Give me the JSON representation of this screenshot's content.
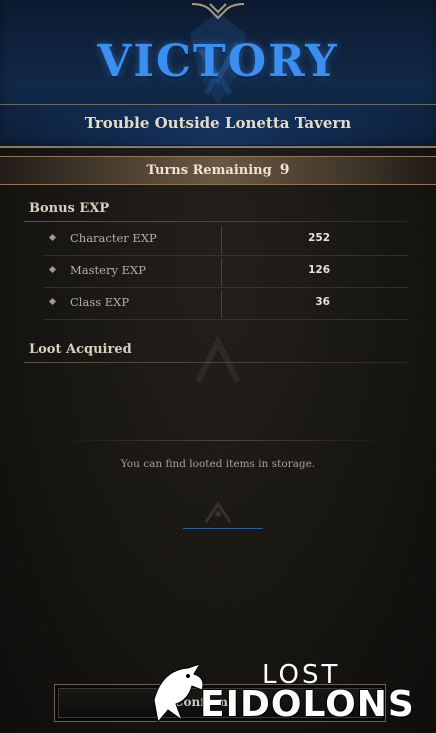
{
  "header": {
    "title": "VICTORY",
    "stage_name": "Trouble Outside Lonetta Tavern"
  },
  "turns": {
    "label": "Turns Remaining",
    "value": "9"
  },
  "bonus_exp": {
    "title": "Bonus EXP",
    "rows": [
      {
        "label": "Character EXP",
        "value": "252"
      },
      {
        "label": "Mastery EXP",
        "value": "126"
      },
      {
        "label": "Class EXP",
        "value": "36"
      }
    ]
  },
  "loot": {
    "title": "Loot Acquired",
    "note": "You can find looted items in storage."
  },
  "footer": {
    "confirm_label": "Confirm"
  },
  "logo": {
    "line1": "LOST",
    "line2": "EIDOLONS"
  },
  "colors": {
    "victory_blue": "#3b8ff0",
    "header_bg": "#112847",
    "turns_bar": "#6b5843"
  },
  "icons": [
    "crest-emblem-icon",
    "diamond-bullet-icon",
    "dragon-logo-icon"
  ]
}
